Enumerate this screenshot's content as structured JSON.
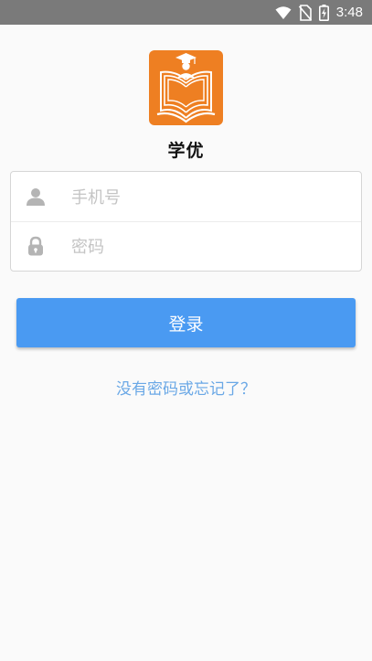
{
  "status_bar": {
    "time": "3:48",
    "icons": [
      "wifi-icon",
      "no-sim-icon",
      "battery-charging-icon"
    ]
  },
  "app": {
    "name": "学优",
    "logo_icon": "graduate-book-logo",
    "brand_color": "#ee7f22"
  },
  "form": {
    "phone": {
      "placeholder": "手机号",
      "value": "",
      "icon": "user-icon"
    },
    "password": {
      "placeholder": "密码",
      "value": "",
      "icon": "lock-icon"
    }
  },
  "login": {
    "label": "登录",
    "color": "#4a9af2"
  },
  "forgot": {
    "label": "没有密码或忘记了？",
    "color": "#6aa8e6"
  }
}
